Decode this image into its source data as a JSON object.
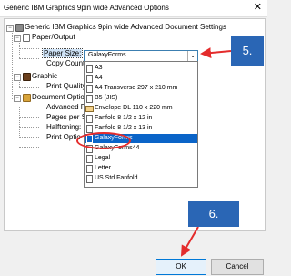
{
  "window": {
    "title": "Generic IBM Graphics 9pin wide Advanced Options",
    "close_glyph": "✕"
  },
  "tree": {
    "root": "Generic IBM Graphics 9pin wide Advanced Document Settings",
    "paper_output": "Paper/Output",
    "paper_size": "Paper Size:",
    "copy_count": "Copy Count",
    "graphic": "Graphic",
    "print_quality": "Print Quality",
    "document_options": "Document Optio",
    "advanced": "Advanced P",
    "pages_per_sheet": "Pages per Sh",
    "halftoning": "Halftoning:",
    "print_options": "Print Optio"
  },
  "paper_size_combo": {
    "value": "GalaxyForms",
    "arrow": "⌄"
  },
  "paper_options": [
    "A3",
    "A4",
    "A4 Transverse 297 x 210 mm",
    "B5 (JIS)",
    "Envelope DL 110 x 220 mm",
    "Fanfold 8 1/2 x 12 in",
    "Fanfold 8 1/2 x 13 in",
    "GalaxyForms",
    "GalaxyForms44",
    "Legal",
    "Letter",
    "US Std Fanfold"
  ],
  "selected_option": "GalaxyForms",
  "callouts": {
    "step5": "5.",
    "step6": "6."
  },
  "buttons": {
    "ok": "OK",
    "cancel": "Cancel"
  },
  "colors": {
    "callout": "#2a66b5",
    "highlight_ring": "#e42c2c",
    "selection": "#0a64c8"
  },
  "icons": {
    "printer": "printer-icon",
    "paper": "paper-icon",
    "graphic": "graphic-icon",
    "document": "document-icon"
  }
}
